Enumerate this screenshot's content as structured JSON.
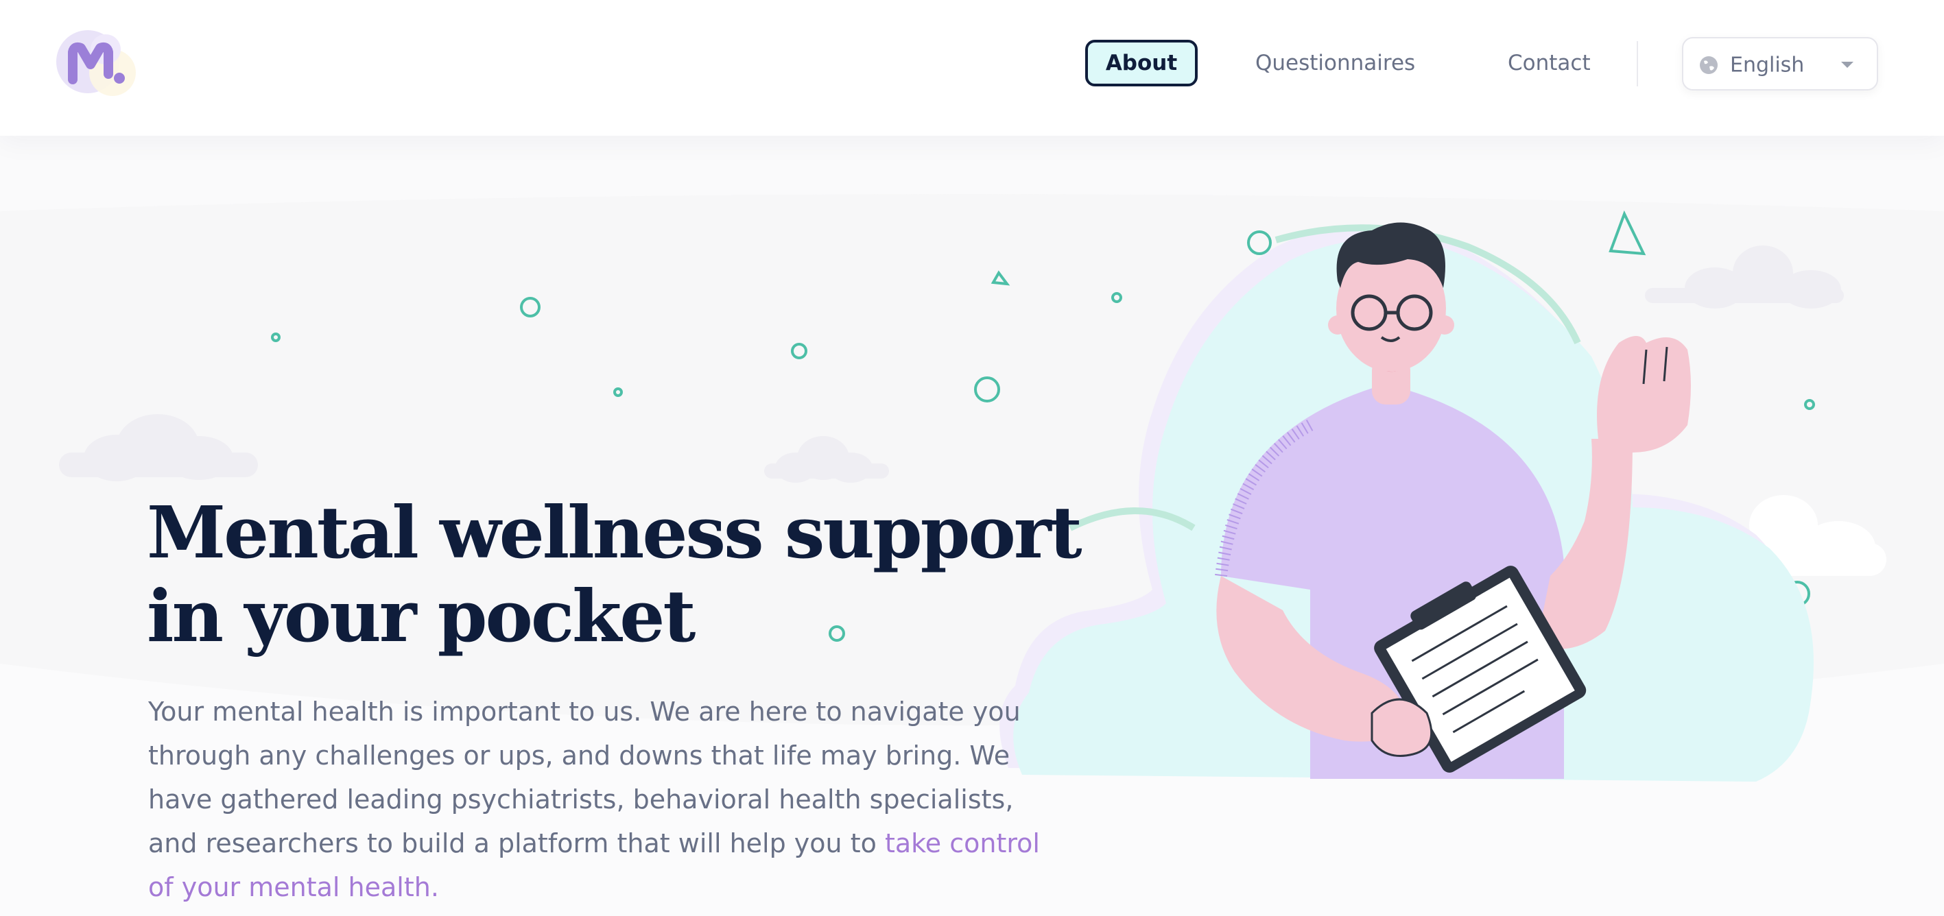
{
  "header": {
    "logo_letter": "M",
    "nav": {
      "about": "About",
      "questionnaires": "Questionnaires",
      "contact": "Contact"
    },
    "language": {
      "selected": "English"
    }
  },
  "hero": {
    "headline_line1": "Mental wellness support",
    "headline_line2": "in your pocket",
    "description_main": "Your mental health is important to us. We are here to navigate you through any challenges or ups, and downs that life may bring. We have gathered leading psychiatrists, behavioral health specialists, and researchers to build a platform that will help you to ",
    "description_highlight": "take control of your mental health."
  },
  "colors": {
    "navy": "#0f1d3b",
    "muted_text": "#687086",
    "accent_purple": "#a47ad6",
    "mint": "#dff8f8",
    "teal_outline": "#4dbfa7",
    "lavender": "#d8c6f5",
    "skin_pink": "#f5c8d2"
  },
  "icons": [
    "logo-icon",
    "globe-icon",
    "caret-down-icon"
  ]
}
